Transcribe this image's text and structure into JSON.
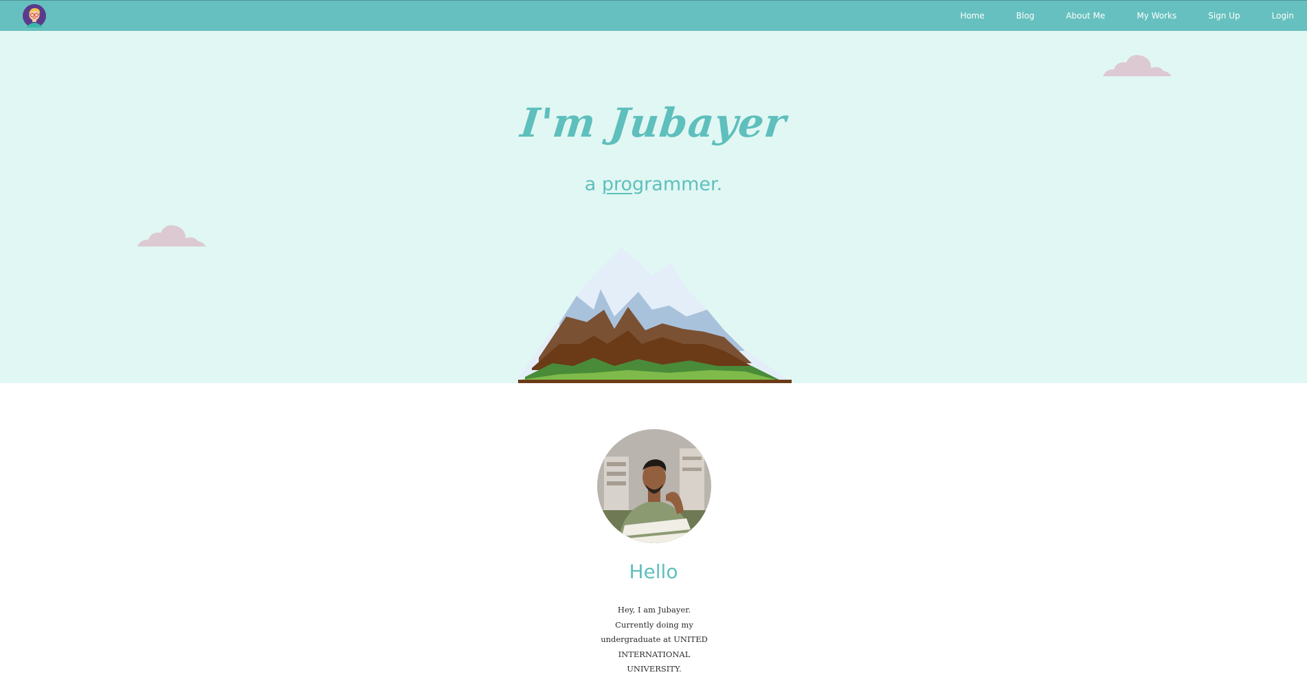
{
  "nav": {
    "logo_icon": "cartoon-avatar-icon",
    "links": [
      "Home",
      "Blog",
      "About Me",
      "My Works",
      "Sign Up",
      "Login"
    ]
  },
  "hero": {
    "title": "I'm Jubayer",
    "subtitle_prefix": "a ",
    "subtitle_typed": "pro",
    "subtitle_rest": "grammer.",
    "colors": {
      "background": "#e1f7f3",
      "accent": "#5ebfbd",
      "cloud": "#dcc9d1"
    }
  },
  "about": {
    "photo": "profile-photo",
    "heading": "Hello",
    "bio": "Hey, I am Jubayer. Currently doing my undergraduate at UNITED INTERNATIONAL UNIVERSITY."
  },
  "colors": {
    "navbar": "#66c0bf",
    "nav_text": "#ffffff"
  }
}
